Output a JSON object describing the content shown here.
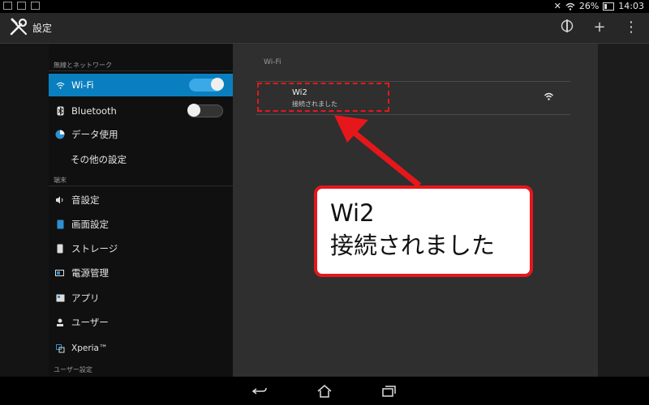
{
  "status_bar": {
    "battery": "26%",
    "time": "14:03"
  },
  "app": {
    "title": "設定",
    "icon": "wrench-screwdriver-icon"
  },
  "action_bar": {
    "add_label": "+",
    "menu_label": "⋮",
    "sync_icon": "sync-icon"
  },
  "sidebar": {
    "section_wireless": "無線とネットワーク",
    "section_device": "端末",
    "section_user": "ユーザー設定",
    "items": [
      {
        "label": "Wi-Fi",
        "icon": "wifi-icon",
        "active": true,
        "toggle": "on"
      },
      {
        "label": "Bluetooth",
        "icon": "bluetooth-icon",
        "toggle": "off"
      },
      {
        "label": "データ使用",
        "icon": "data-usage-icon"
      },
      {
        "label": "その他の設定"
      },
      {
        "label": "音設定",
        "icon": "sound-icon"
      },
      {
        "label": "画面設定",
        "icon": "display-icon"
      },
      {
        "label": "ストレージ",
        "icon": "storage-icon"
      },
      {
        "label": "電源管理",
        "icon": "battery-icon"
      },
      {
        "label": "アプリ",
        "icon": "apps-icon"
      },
      {
        "label": "ユーザー",
        "icon": "user-icon"
      },
      {
        "label": "Xperia™",
        "icon": "xperia-icon"
      }
    ]
  },
  "wifi_panel": {
    "title": "Wi-Fi",
    "network": {
      "name": "Wi2",
      "status": "接続されました",
      "signal_icon": "wifi-signal-icon"
    }
  },
  "annotation": {
    "line1": "Wi2",
    "line2": "接続されました",
    "color": "#e6171b"
  },
  "colors": {
    "accent": "#0a7fbf",
    "toggle_on": "#3aa9e6"
  }
}
